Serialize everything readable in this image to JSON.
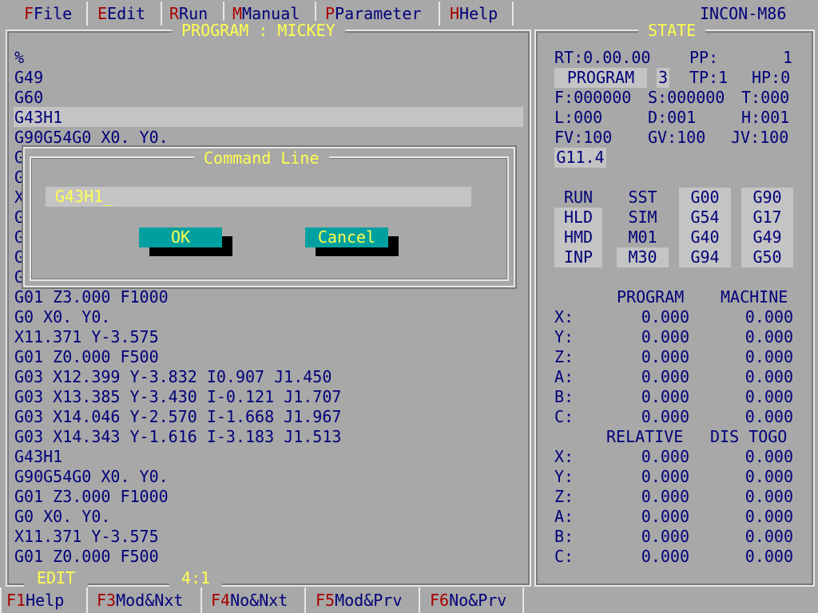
{
  "menu": {
    "items": [
      {
        "key": "F",
        "label": "File"
      },
      {
        "key": "E",
        "label": "Edit"
      },
      {
        "key": "R",
        "label": "Run"
      },
      {
        "key": "M",
        "label": "Manual"
      },
      {
        "key": "P",
        "label": "Parameter"
      },
      {
        "key": "H",
        "label": "Help"
      }
    ],
    "brand": "INCON-M86"
  },
  "program": {
    "title": "PROGRAM : MICKEY",
    "lines": [
      "%",
      "G49",
      "G60",
      "G43H1",
      "G90G54G0 X0. Y0.",
      "G",
      "G",
      "X",
      "G",
      "G",
      "G",
      "G",
      "G01 Z3.000 F1000",
      "G0 X0. Y0.",
      "X11.371 Y-3.575",
      "G01 Z0.000 F500",
      "G03 X12.399 Y-3.832 I0.907 J1.450",
      "G03 X13.385 Y-3.430 I-0.121 J1.707",
      "G03 X14.046 Y-2.570 I-1.668 J1.967",
      "G03 X14.343 Y-1.616 I-3.183 J1.513",
      "G43H1",
      "G90G54G0 X0. Y0.",
      "G01 Z3.000 F1000",
      "G0 X0. Y0.",
      "X11.371 Y-3.575",
      "G01 Z0.000 F500"
    ],
    "mode": "EDIT",
    "position": "4:1"
  },
  "dialog": {
    "title": "Command Line",
    "input_value": "G43H1",
    "ok_label": "OK",
    "cancel_label": "Cancel"
  },
  "state": {
    "title": "STATE",
    "rt": "RT:0.00.00",
    "pp_label": "PP:",
    "pp_value": "1",
    "program_label": "PROGRAM",
    "program_num": "3",
    "tp": "TP:1",
    "hp": "HP:0",
    "f": "F:000000",
    "s": "S:000000",
    "t": "T:000",
    "l": "L:000",
    "d": "D:001",
    "h": "H:001",
    "fv": "FV:100",
    "gv": "GV:100",
    "jv": "JV:100",
    "gcode": "G11.4",
    "modes_col1": [
      "RUN",
      "HLD",
      "HMD",
      "INP"
    ],
    "modes_col2": [
      "SST",
      "SIM",
      "M01",
      "M30"
    ],
    "modes_col3": [
      "G00",
      "G54",
      "G40",
      "G94"
    ],
    "modes_col4": [
      "G90",
      "G17",
      "G49",
      "G50"
    ],
    "header1_a": "PROGRAM",
    "header1_b": "MACHINE",
    "header2_a": "RELATIVE",
    "header2_b": "DIS TOGO",
    "axes": [
      "X:",
      "Y:",
      "Z:",
      "A:",
      "B:",
      "C:"
    ],
    "coords1": [
      [
        "0.000",
        "0.000"
      ],
      [
        "0.000",
        "0.000"
      ],
      [
        "0.000",
        "0.000"
      ],
      [
        "0.000",
        "0.000"
      ],
      [
        "0.000",
        "0.000"
      ],
      [
        "0.000",
        "0.000"
      ]
    ],
    "coords2": [
      [
        "0.000",
        "0.000"
      ],
      [
        "0.000",
        "0.000"
      ],
      [
        "0.000",
        "0.000"
      ],
      [
        "0.000",
        "0.000"
      ],
      [
        "0.000",
        "0.000"
      ],
      [
        "0.000",
        "0.000"
      ]
    ]
  },
  "funcbar": {
    "items": [
      {
        "key": "F1",
        "label": "Help"
      },
      {
        "key": "F3",
        "label": "Mod&Nxt"
      },
      {
        "key": "F4",
        "label": "No&Nxt"
      },
      {
        "key": "F5",
        "label": "Mod&Prv"
      },
      {
        "key": "F6",
        "label": "No&Prv"
      }
    ]
  },
  "colors": {
    "background": "#a8a8a8",
    "text": "#00007a",
    "title": "#ffff50",
    "hotkey": "#a80000",
    "button": "#00a0a0",
    "highlight": "#c4c4c4"
  }
}
